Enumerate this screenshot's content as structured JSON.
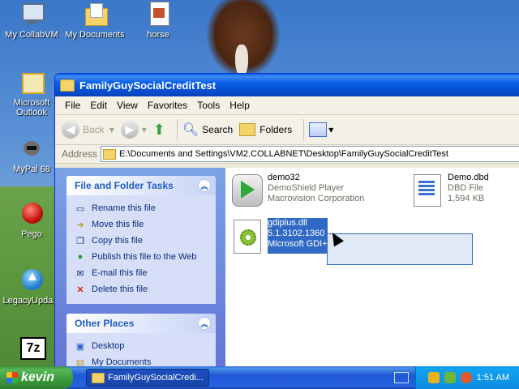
{
  "desktop": {
    "icons": [
      {
        "label": "My CollabVM"
      },
      {
        "label": "My Documents"
      },
      {
        "label": "horse"
      },
      {
        "label": "Microsoft Outlook"
      },
      {
        "label": "MyPal 68"
      },
      {
        "label": "Pego"
      },
      {
        "label": "LegacyUpda..."
      },
      {
        "label": "7z"
      }
    ]
  },
  "window": {
    "title": "FamilyGuySocialCreditTest",
    "menu": [
      "File",
      "Edit",
      "View",
      "Favorites",
      "Tools",
      "Help"
    ],
    "toolbar": {
      "back": "Back",
      "search": "Search",
      "folders": "Folders"
    },
    "address_label": "Address",
    "address": "E:\\Documents and Settings\\VM2.COLLABNET\\Desktop\\FamilyGuySocialCreditTest"
  },
  "tasks_panel": {
    "title": "File and Folder Tasks",
    "items": [
      "Rename this file",
      "Move this file",
      "Copy this file",
      "Publish this file to the Web",
      "E-mail this file",
      "Delete this file"
    ]
  },
  "places_panel": {
    "title": "Other Places",
    "items": [
      "Desktop",
      "My Documents"
    ]
  },
  "files": [
    {
      "name": "demo32",
      "line2": "DemoShield Player",
      "line3": "Macrovision Corporation"
    },
    {
      "name": "Demo.dbd",
      "line2": "DBD File",
      "line3": "1,594 KB"
    },
    {
      "name": "gdiplus.dll",
      "line2": "5.1.3102.1360",
      "line3": "Microsoft GDI+"
    }
  ],
  "taskbar": {
    "start_label": "kevin",
    "window_button": "FamilyGuySocialCredi...",
    "clock": "1:51 AM"
  }
}
